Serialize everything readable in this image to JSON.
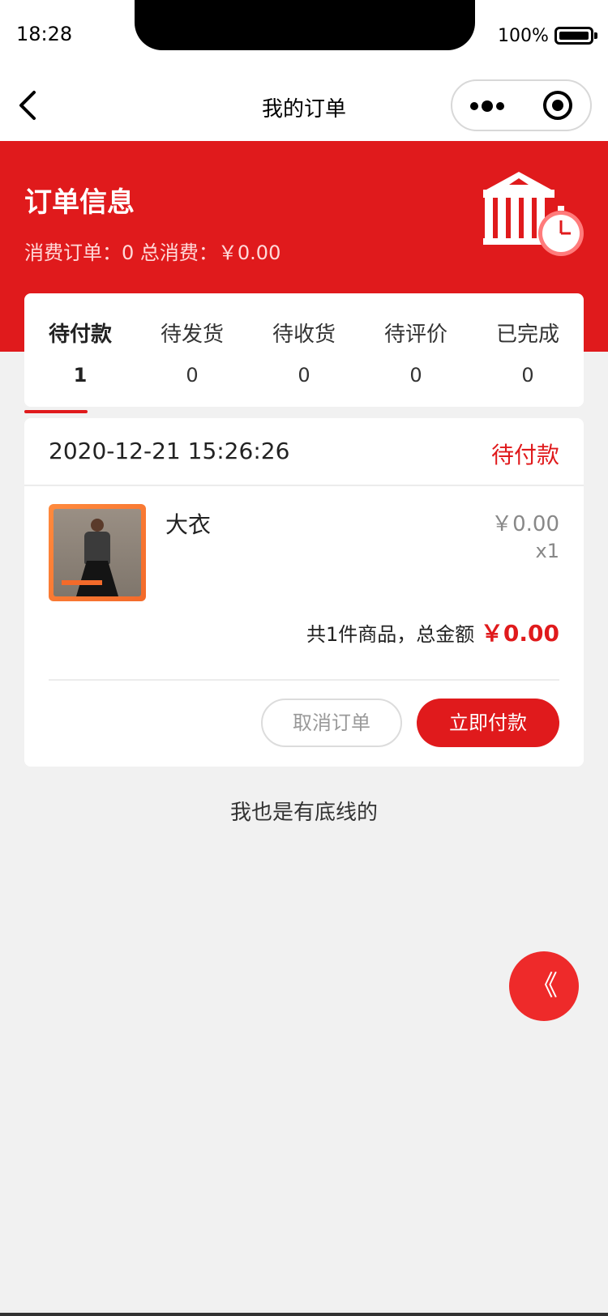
{
  "status_bar": {
    "time": "18:28",
    "battery_percent": "100%",
    "battery_level": 1.0
  },
  "nav": {
    "title": "我的订单",
    "back_icon": "chevron-left-icon",
    "more_icon": "more-dots-icon",
    "home_icon": "target-circle-icon"
  },
  "header": {
    "title": "订单信息",
    "stats": "消费订单：0 总消费：￥0.00",
    "illustration_icon": "shop-clock-icon",
    "background_color": "#e01a1c"
  },
  "tabs": [
    {
      "label": "待付款",
      "count": "1",
      "active": true
    },
    {
      "label": "待发货",
      "count": "0",
      "active": false
    },
    {
      "label": "待收货",
      "count": "0",
      "active": false
    },
    {
      "label": "待评价",
      "count": "0",
      "active": false
    },
    {
      "label": "已完成",
      "count": "0",
      "active": false
    }
  ],
  "order": {
    "datetime": "2020-12-21 15:26:26",
    "status": "待付款",
    "product": {
      "name": "大衣",
      "price": "￥0.00",
      "quantity": "x1"
    },
    "summary_prefix": "共1件商品，总金额",
    "summary_total": "￥0.00",
    "cancel_label": "取消订单",
    "pay_label": "立即付款"
  },
  "footer_text": "我也是有底线的",
  "float_button": {
    "label": "《",
    "icon": "double-chevron-left-icon"
  },
  "colors": {
    "accent": "#e01a1c",
    "page_bg": "#f1f1f1"
  }
}
